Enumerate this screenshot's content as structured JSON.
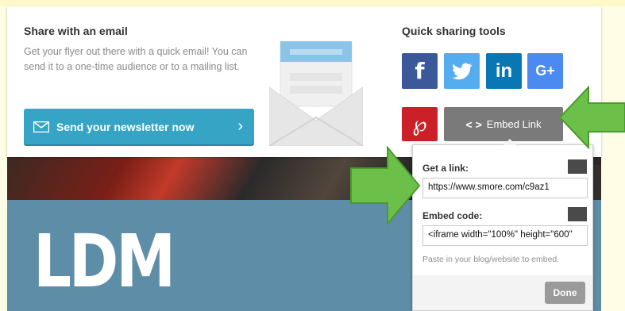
{
  "email": {
    "title": "Share with an email",
    "description": "Get your flyer out there with a quick email! You can send it to a one-time audience or to a mailing list.",
    "send_button_label": "Send your newsletter now"
  },
  "quick_sharing": {
    "title": "Quick sharing tools",
    "facebook_label": "f",
    "linkedin_label": "in",
    "googleplus_label": "G+",
    "embed_link_label": "Embed Link"
  },
  "embed_popup": {
    "get_link_label": "Get a link:",
    "link_value": "https://www.smore.com/c9az1",
    "embed_code_label": "Embed code:",
    "embed_code_value": "<iframe width=\"100%\" height=\"600\"",
    "hint": "Paste in your blog/website to embed.",
    "done_label": "Done"
  },
  "background": {
    "headline": "LDM"
  },
  "colors": {
    "send_button": "#35a4c5",
    "facebook": "#3b5998",
    "twitter": "#55acee",
    "linkedin": "#0a77b5",
    "googleplus": "#4b8af0",
    "pinterest": "#cb2027",
    "embed_button": "#7a7a7a",
    "arrow": "#6cc04a",
    "blue_panel": "#5e8ea7"
  },
  "icons": [
    "envelope-icon",
    "chevron-right-icon",
    "facebook-icon",
    "twitter-icon",
    "linkedin-icon",
    "googleplus-icon",
    "pinterest-icon",
    "code-brackets-icon",
    "arrow-pointer-icon"
  ]
}
